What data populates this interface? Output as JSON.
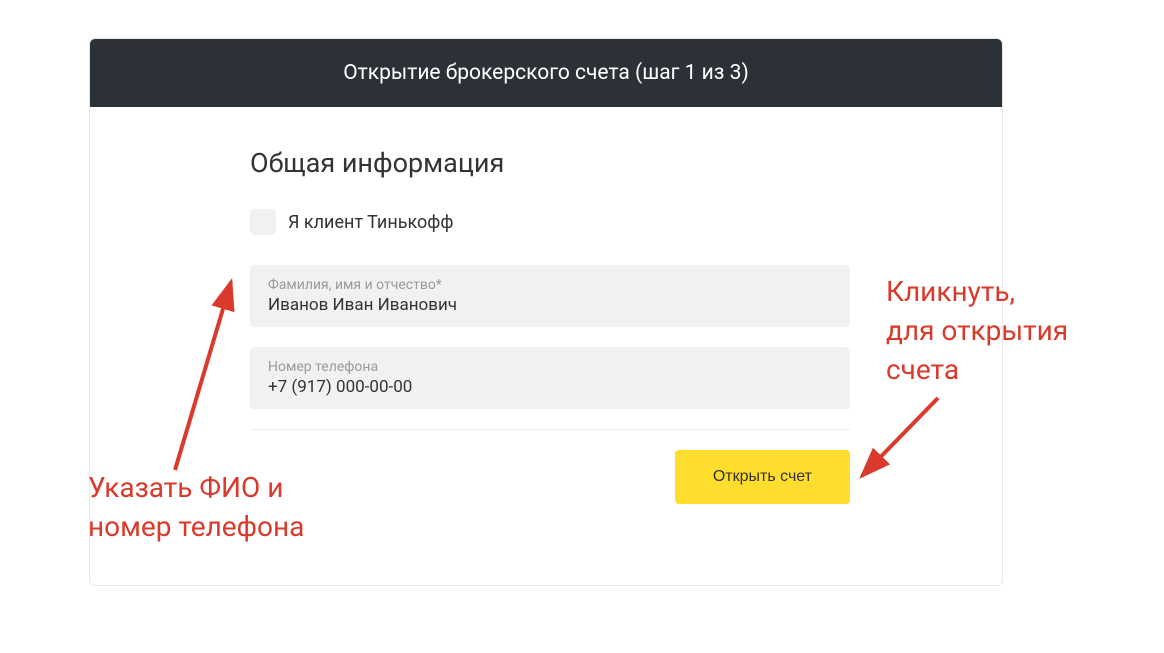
{
  "header": {
    "title": "Открытие брокерского счета (шаг 1 из 3)"
  },
  "section": {
    "title": "Общая информация"
  },
  "checkbox": {
    "label": "Я клиент Тинькофф"
  },
  "fields": {
    "fullname": {
      "label": "Фамилия, имя и отчество*",
      "value": "Иванов Иван Иванович"
    },
    "phone": {
      "label": "Номер телефона",
      "value": "+7 (917) 000-00-00"
    }
  },
  "buttons": {
    "submit": "Открыть счет"
  },
  "annotations": {
    "left": "Указать ФИО и номер телефона",
    "right": "Кликнуть, для открытия счета"
  }
}
